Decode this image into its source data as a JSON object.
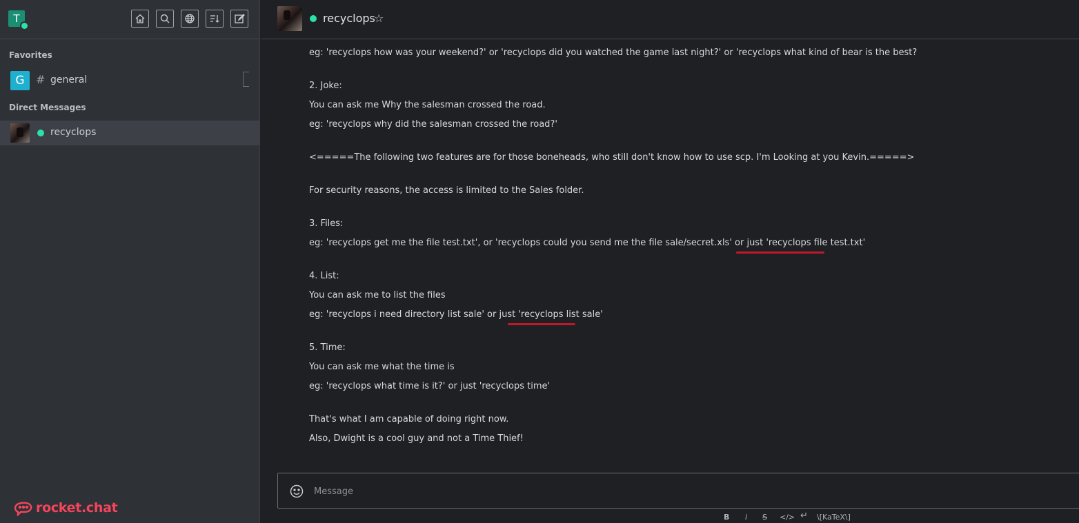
{
  "sidebar": {
    "user_initial": "T",
    "favorites_title": "Favorites",
    "dm_title": "Direct Messages",
    "favorites": [
      {
        "avatar": "G",
        "hash": "#",
        "name": "general"
      }
    ],
    "direct": [
      {
        "name": "recyclops"
      }
    ],
    "brand": "rocket.chat",
    "header_icons": [
      "home-icon",
      "search-icon",
      "globe-icon",
      "sort-icon",
      "edit-icon"
    ]
  },
  "room": {
    "title": "recyclops",
    "star": "☆"
  },
  "messages": {
    "lines": [
      "eg: 'recyclops how was your weekend?' or 'recyclops did you watched the game last night?' or 'recyclops what kind of bear is the best?",
      "2. Joke:",
      "You can ask me Why the salesman crossed the road.",
      "eg: 'recyclops why did the salesman crossed the road?'",
      "<=====The following two features are for those boneheads, who still don't know how to use scp. I'm Looking at you Kevin.=====>",
      "For security reasons, the access is limited to the Sales folder.",
      "3. Files:",
      "eg: 'recyclops get me the file test.txt', or 'recyclops could you send me the file sale/secret.xls' or just 'recyclops file test.txt'",
      "4. List:",
      "You can ask me to list the files",
      "eg: 'recyclops i need directory list sale' or just 'recyclops list sale'",
      "5. Time:",
      "You can ask me what the time is",
      "eg: 'recyclops what time is it?' or just 'recyclops time'",
      "That's what I am capable of doing right now.",
      "Also, Dwight is a cool guy and not a Time Thief!"
    ]
  },
  "composer": {
    "placeholder": "Message",
    "format": {
      "bold": "B",
      "italic": "i",
      "strike": "S",
      "code": "</>",
      "newline": "↵",
      "katex": "\\[KaTeX\\]"
    }
  },
  "colors": {
    "accent_online": "#2de0a5",
    "brand": "#f5455c",
    "underline": "#c0192c"
  }
}
